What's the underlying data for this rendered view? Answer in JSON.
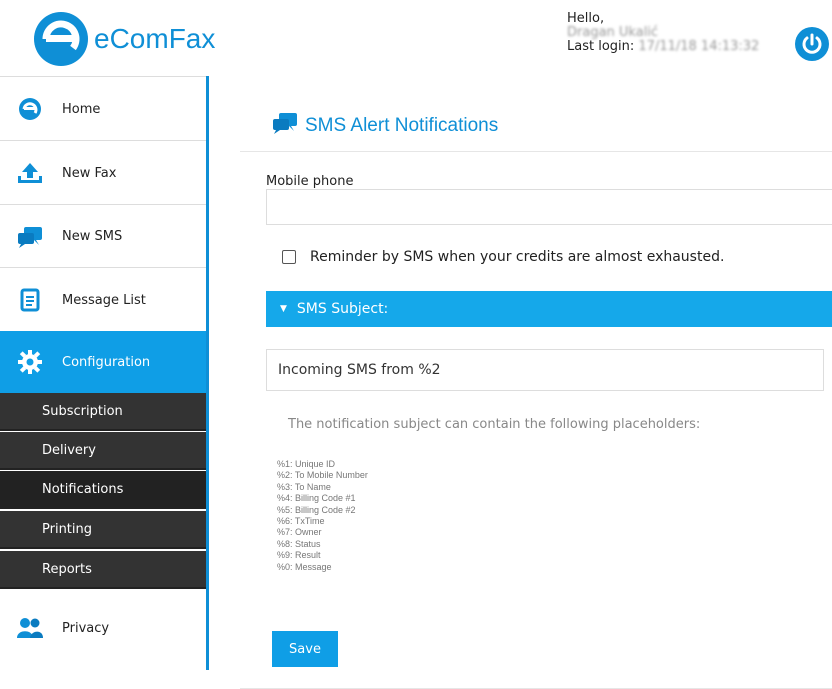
{
  "header": {
    "brand": "eComFax",
    "hello": "Hello,",
    "user_name": "Dragan Ukalić",
    "last_login_label": "Last login:",
    "last_login_value": "17/11/18 14:13:32"
  },
  "sidebar": {
    "items": [
      {
        "label": "Home",
        "icon": "home-icon"
      },
      {
        "label": "New Fax",
        "icon": "upload-icon"
      },
      {
        "label": "New SMS",
        "icon": "chat-icon"
      },
      {
        "label": "Message List",
        "icon": "document-list-icon"
      },
      {
        "label": "Configuration",
        "icon": "gear-icon"
      },
      {
        "label": "Privacy",
        "icon": "users-icon"
      }
    ],
    "submenu": [
      "Subscription",
      "Delivery",
      "Notifications",
      "Printing",
      "Reports"
    ]
  },
  "page": {
    "title": "SMS Alert Notifications",
    "mobile_label": "Mobile phone",
    "mobile_value": "",
    "reminder_label": "Reminder by SMS when your credits are almost exhausted.",
    "reminder_checked": false,
    "subject_section": "SMS Subject:",
    "subject_value": "Incoming SMS from %2",
    "hint": "The notification subject can contain the following placeholders:",
    "placeholders": [
      "%1: Unique ID",
      "%2: To Mobile Number",
      "%3: To Name",
      "%4: Billing Code #1",
      "%5: Billing Code #2",
      "%6: TxTime",
      "%7: Owner",
      "%8: Status",
      "%9: Result",
      "%0: Message"
    ],
    "save_label": "Save"
  },
  "colors": {
    "accent": "#0f9ee6",
    "brand": "#0f8fd6",
    "submenu_bg": "#333333"
  }
}
